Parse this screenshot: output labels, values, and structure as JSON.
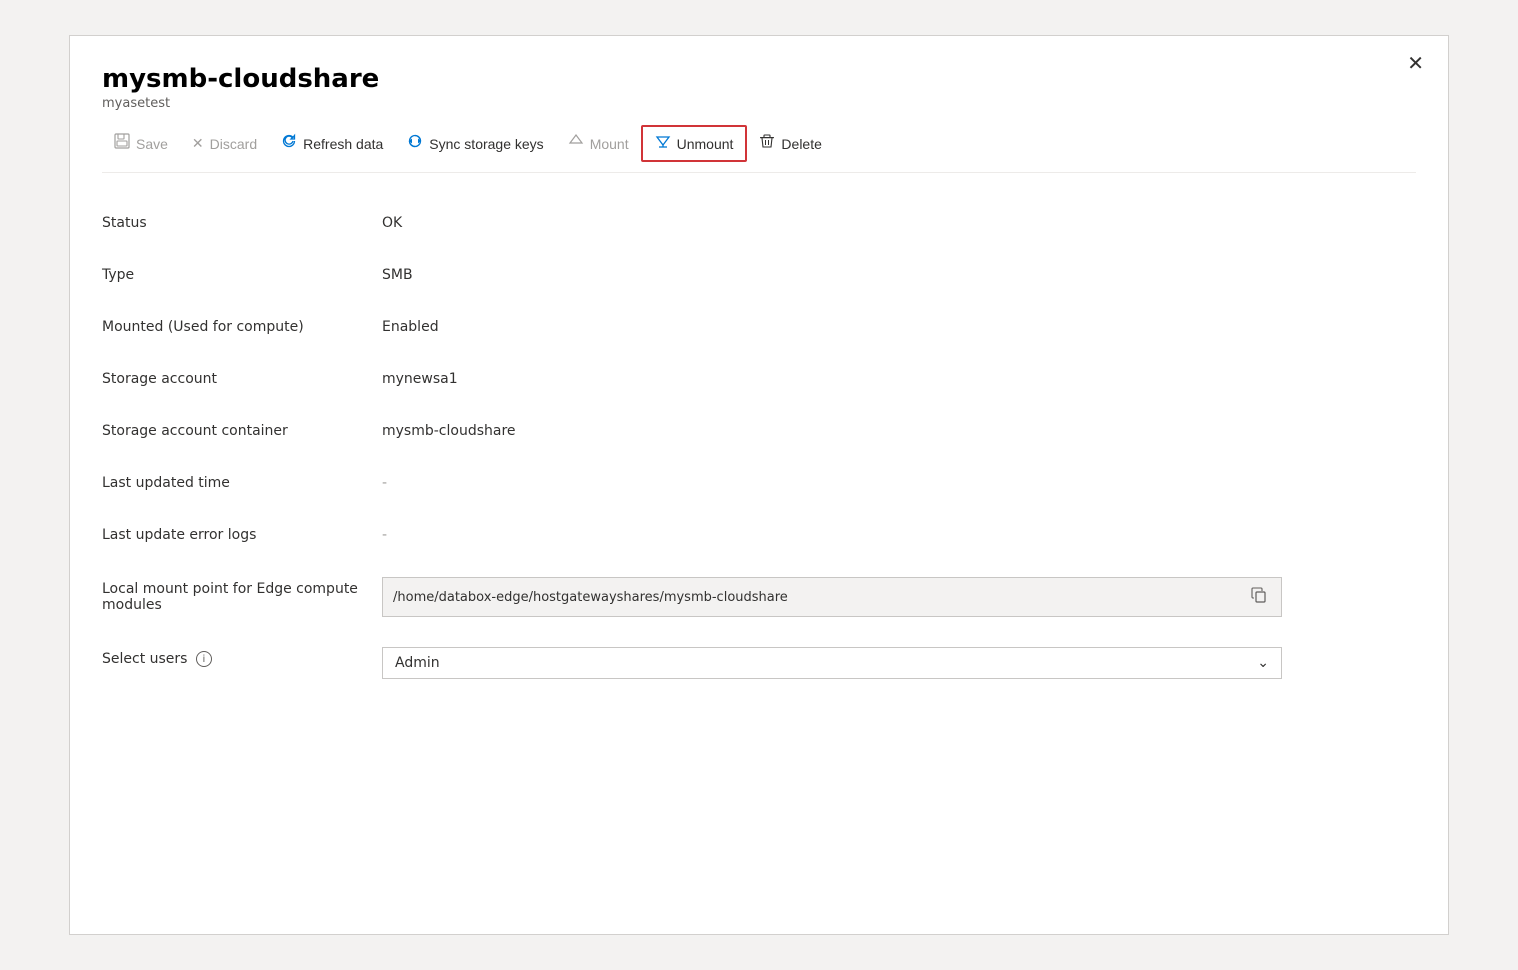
{
  "panel": {
    "title": "mysmb-cloudshare",
    "subtitle": "myasetest"
  },
  "toolbar": {
    "save_label": "Save",
    "discard_label": "Discard",
    "refresh_label": "Refresh data",
    "sync_label": "Sync storage keys",
    "mount_label": "Mount",
    "unmount_label": "Unmount",
    "delete_label": "Delete"
  },
  "fields": [
    {
      "label": "Status",
      "value": "OK",
      "type": "text"
    },
    {
      "label": "Type",
      "value": "SMB",
      "type": "text"
    },
    {
      "label": "Mounted (Used for compute)",
      "value": "Enabled",
      "type": "text"
    },
    {
      "label": "Storage account",
      "value": "mynewsa1",
      "type": "text"
    },
    {
      "label": "Storage account container",
      "value": "mysmb-cloudshare",
      "type": "text"
    },
    {
      "label": "Last updated time",
      "value": "-",
      "type": "text"
    },
    {
      "label": "Last update error logs",
      "value": "-",
      "type": "text"
    },
    {
      "label": "Local mount point for Edge compute modules",
      "value": "/home/databox-edge/hostgatewayshares/mysmb-cloudshare",
      "type": "copy"
    },
    {
      "label": "Select users",
      "value": "Admin",
      "type": "select"
    }
  ],
  "close_label": "✕"
}
